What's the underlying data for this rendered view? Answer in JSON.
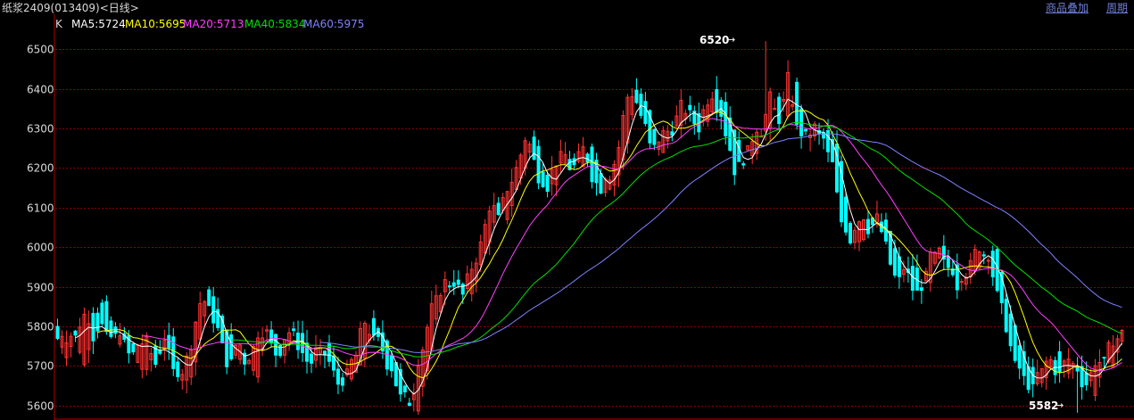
{
  "header": {
    "title": "纸浆2409(013409)<日线>",
    "overlay_link": "商品叠加",
    "period_link": "周期"
  },
  "legend": {
    "prefix": "K",
    "items": [
      {
        "text": "MA5:5724",
        "color": "#ffffff"
      },
      {
        "text": "MA10:5695",
        "color": "#ffff00"
      },
      {
        "text": "MA20:5713",
        "color": "#ff40ff"
      },
      {
        "text": "MA40:5834",
        "color": "#00e000"
      },
      {
        "text": "MA60:5975",
        "color": "#8080ff"
      }
    ]
  },
  "annotations": {
    "high_label": "6520",
    "low_label": "5582"
  },
  "colors": {
    "up": "#ff3232",
    "down": "#00ffff",
    "grid": "#8b0000",
    "axis_text": "#d8d8d8"
  },
  "chart_data": {
    "type": "candlestick",
    "ylim": [
      5575,
      6570
    ],
    "yticks": [
      5600,
      5700,
      5800,
      5900,
      6000,
      6100,
      6200,
      6300,
      6400,
      6500
    ],
    "grid": true,
    "high": 6520,
    "low": 5582,
    "ohlc_anchors": [
      [
        5800,
        5770
      ],
      [
        5720,
        5780
      ],
      [
        5790,
        5770
      ],
      [
        5700,
        5830
      ],
      [
        5840,
        5780
      ],
      [
        5860,
        5800
      ],
      [
        5810,
        5770
      ],
      [
        5750,
        5800
      ],
      [
        5780,
        5720
      ],
      [
        5700,
        5760
      ],
      [
        5690,
        5750
      ],
      [
        5760,
        5700
      ],
      [
        5740,
        5790
      ],
      [
        5780,
        5660
      ],
      [
        5640,
        5700
      ],
      [
        5680,
        5780
      ],
      [
        5790,
        5880
      ],
      [
        5920,
        5820
      ],
      [
        5820,
        5780
      ],
      [
        5780,
        5700
      ],
      [
        5710,
        5770
      ],
      [
        5740,
        5700
      ],
      [
        5670,
        5760
      ],
      [
        5770,
        5810
      ],
      [
        5800,
        5720
      ],
      [
        5730,
        5760
      ],
      [
        5770,
        5800
      ],
      [
        5790,
        5740
      ],
      [
        5740,
        5700
      ],
      [
        5700,
        5750
      ],
      [
        5760,
        5720
      ],
      [
        5700,
        5650
      ],
      [
        5650,
        5690
      ],
      [
        5680,
        5720
      ],
      [
        5720,
        5810
      ],
      [
        5800,
        5780
      ],
      [
        5790,
        5740
      ],
      [
        5740,
        5690
      ],
      [
        5680,
        5630
      ],
      [
        5620,
        5600
      ],
      [
        5610,
        5700
      ],
      [
        5690,
        5800
      ],
      [
        5800,
        5880
      ],
      [
        5880,
        5920
      ],
      [
        5930,
        5900
      ],
      [
        5900,
        5880
      ],
      [
        5890,
        5950
      ],
      [
        5950,
        6020
      ],
      [
        6040,
        6100
      ],
      [
        6100,
        6080
      ],
      [
        6080,
        6150
      ],
      [
        6150,
        6210
      ],
      [
        6220,
        6280
      ],
      [
        6280,
        6210
      ],
      [
        6200,
        6140
      ],
      [
        6140,
        6210
      ],
      [
        6200,
        6250
      ],
      [
        6240,
        6180
      ],
      [
        6180,
        6260
      ],
      [
        6270,
        6200
      ],
      [
        6200,
        6150
      ],
      [
        6140,
        6180
      ],
      [
        6170,
        6220
      ],
      [
        6230,
        6380
      ],
      [
        6400,
        6380
      ],
      [
        6380,
        6310
      ],
      [
        6310,
        6240
      ],
      [
        6230,
        6280
      ],
      [
        6290,
        6300
      ],
      [
        6300,
        6350
      ],
      [
        6360,
        6330
      ],
      [
        6340,
        6300
      ],
      [
        6310,
        6380
      ],
      [
        6400,
        6370
      ],
      [
        6370,
        6300
      ],
      [
        6300,
        6200
      ],
      [
        6210,
        6230
      ],
      [
        6230,
        6280
      ],
      [
        6280,
        6300
      ],
      [
        6300,
        6370
      ],
      [
        6380,
        6330
      ],
      [
        6330,
        6420
      ],
      [
        6420,
        6290
      ],
      [
        6290,
        6270
      ],
      [
        6280,
        6300
      ],
      [
        6290,
        6270
      ],
      [
        6270,
        6200
      ],
      [
        6210,
        6050
      ],
      [
        6040,
        6020
      ],
      [
        6010,
        6080
      ],
      [
        6080,
        6050
      ],
      [
        6060,
        6070
      ],
      [
        6070,
        5980
      ],
      [
        5980,
        5910
      ],
      [
        5920,
        5960
      ],
      [
        5960,
        5880
      ],
      [
        5880,
        5920
      ],
      [
        5920,
        5990
      ],
      [
        5990,
        5980
      ],
      [
        5970,
        5940
      ],
      [
        5950,
        5900
      ],
      [
        5890,
        5960
      ],
      [
        5960,
        5990
      ],
      [
        5990,
        5980
      ],
      [
        5990,
        5910
      ],
      [
        5910,
        5800
      ],
      [
        5790,
        5720
      ],
      [
        5730,
        5680
      ],
      [
        5680,
        5650
      ],
      [
        5640,
        5690
      ],
      [
        5690,
        5720
      ],
      [
        5730,
        5680
      ],
      [
        5680,
        5720
      ],
      [
        5710,
        5690
      ],
      [
        5690,
        5650
      ],
      [
        5640,
        5700
      ],
      [
        5700,
        5720
      ],
      [
        5720,
        5750
      ],
      [
        5750,
        5790
      ]
    ]
  }
}
